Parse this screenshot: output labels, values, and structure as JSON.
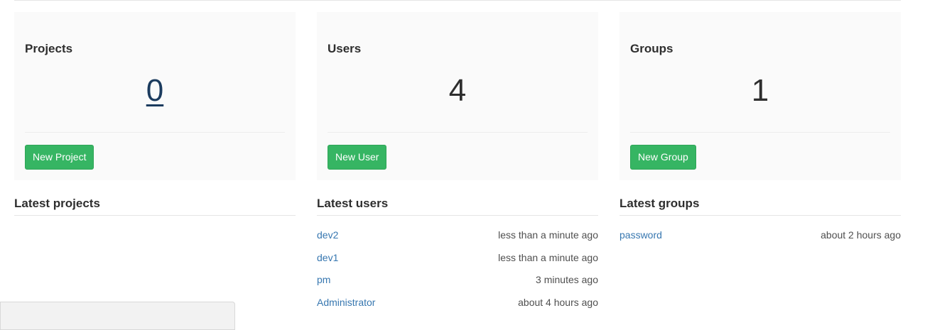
{
  "cards": {
    "projects": {
      "title": "Projects",
      "count": "0",
      "button": "New Project"
    },
    "users": {
      "title": "Users",
      "count": "4",
      "button": "New User"
    },
    "groups": {
      "title": "Groups",
      "count": "1",
      "button": "New Group"
    }
  },
  "latest_projects": {
    "title": "Latest projects",
    "items": []
  },
  "latest_users": {
    "title": "Latest users",
    "items": [
      {
        "name": "dev2",
        "time": "less than a minute ago"
      },
      {
        "name": "dev1",
        "time": "less than a minute ago"
      },
      {
        "name": "pm",
        "time": "3 minutes ago"
      },
      {
        "name": "Administrator",
        "time": "about 4 hours ago"
      }
    ]
  },
  "latest_groups": {
    "title": "Latest groups",
    "items": [
      {
        "name": "password",
        "time": "about 2 hours ago"
      }
    ]
  },
  "colors": {
    "button_green": "#36b563",
    "link_blue": "#3777b0",
    "card_background": "#fafafa"
  }
}
